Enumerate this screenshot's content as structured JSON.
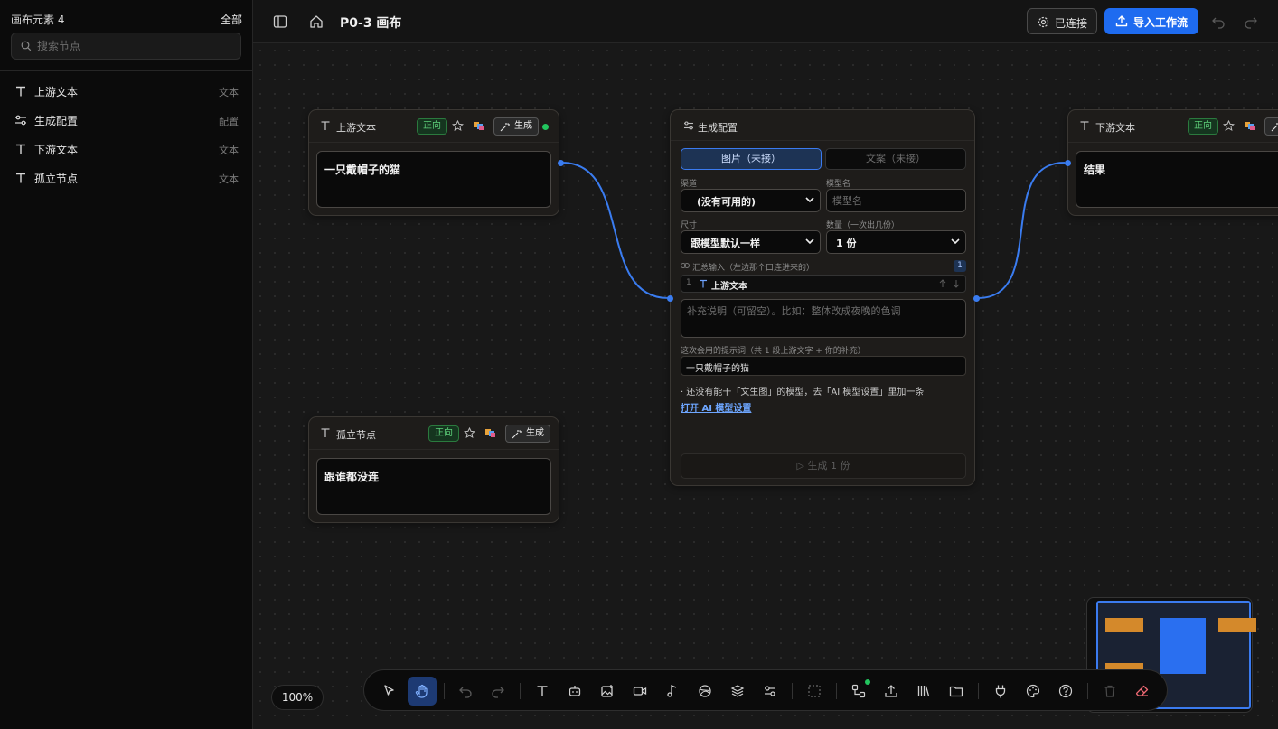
{
  "sidebar": {
    "title": "画布元素 4",
    "all_label": "全部",
    "search_placeholder": "搜索节点",
    "items": [
      {
        "label": "上游文本",
        "kind": "文本",
        "icon": "text-icon"
      },
      {
        "label": "生成配置",
        "kind": "配置",
        "icon": "sliders-icon"
      },
      {
        "label": "下游文本",
        "kind": "文本",
        "icon": "text-icon"
      },
      {
        "label": "孤立节点",
        "kind": "文本",
        "icon": "text-icon"
      }
    ]
  },
  "header": {
    "title": "P0-3 画布",
    "connect_label": "已连接",
    "import_label": "导入工作流"
  },
  "nodes": {
    "upstream": {
      "title": "上游文本",
      "direction": "正向",
      "generate": "生成",
      "content": "一只戴帽子的猫"
    },
    "downstream": {
      "title": "下游文本",
      "direction": "正向",
      "content": "结果"
    },
    "isolated": {
      "title": "孤立节点",
      "direction": "正向",
      "generate": "生成",
      "content": "跟谁都没连"
    },
    "config": {
      "title": "生成配置",
      "tab_image": "图片（未接）",
      "tab_copy": "文案（未接）",
      "channel_label": "渠道",
      "channel_value": "(没有可用的)",
      "model_label": "模型名",
      "model_placeholder": "模型名",
      "size_label": "尺寸",
      "size_value": "跟模型默认一样",
      "count_label": "数量（一次出几份）",
      "count_value": "1 份",
      "inputs_label": "汇总输入（左边那个口连进来的）",
      "inputs_count": "1",
      "input_row_index": "1",
      "input_row_label": "上游文本",
      "note_placeholder": "补充说明（可留空）。比如：整体改成夜晚的色调",
      "prompt_label": "这次会用的提示词（共 1 段上游文字 + 你的补充）",
      "prompt_value": "一只戴帽子的猫",
      "warning": "· 还没有能干「文生图」的模型，去「AI 模型设置」里加一条",
      "settings_link": "打开 AI 模型设置",
      "generate_button": "▷ 生成 1 份"
    }
  },
  "zoom": "100%",
  "colors": {
    "accent": "#1e6bf0",
    "edge": "#3a7cf0",
    "status_ok": "#22c55e",
    "badge_green": "#5ed07a",
    "minimap_text_node": "#d4892b",
    "minimap_config_node": "#2a6ff0"
  }
}
